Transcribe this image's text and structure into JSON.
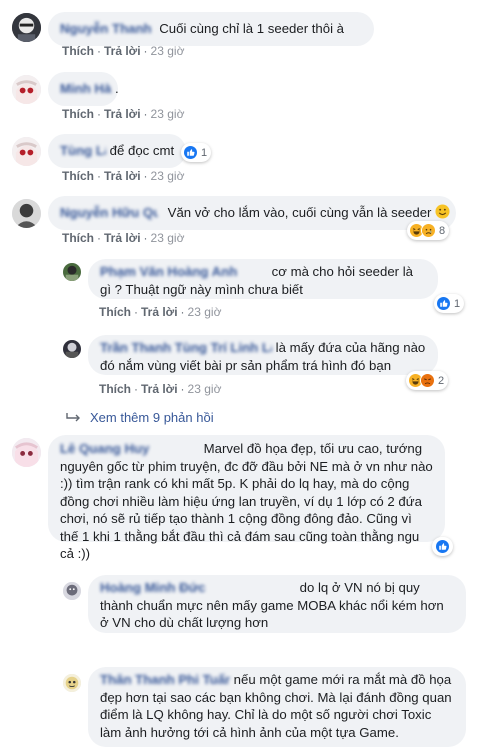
{
  "actions": {
    "like": "Thích",
    "reply": "Trả lời",
    "separator": "·"
  },
  "comments": [
    {
      "name": "Nguyễn Thanh",
      "text": "Cuối cùng chỉ là 1 seeder thôi à",
      "time": "23 giờ"
    },
    {
      "name": "Minh Hà",
      "text": ".",
      "time": "23 giờ"
    },
    {
      "name": "Tùng Lâm",
      "text": "để đọc cmt",
      "time": "23 giờ",
      "reaction_count": "1"
    },
    {
      "name": "Nguyễn Hữu Quang",
      "text": "Văn vở cho lắm vào, cuối cùng vẫn là seeder",
      "time": "23 giờ",
      "reaction_count": "8"
    },
    {
      "name": "Phạm Văn Hoàng Anh",
      "text": "cơ mà cho hỏi seeder là gì ? Thuật ngữ này mình chưa biết",
      "time": "23 giờ",
      "reaction_count": "1"
    },
    {
      "name": "Trần Thanh Tùng Trí Linh Lam",
      "text": "là mấy đứa của hãng nào đó nắm vùng viết bài pr sản phẩm trá hình đó bạn",
      "time": "23 giờ",
      "reaction_count": "2"
    },
    {
      "name": "Lê Quang Huy",
      "text": "Marvel đồ họa đẹp, tối ưu cao, tướng nguyên gốc từ phim truyện, đc đỡ đầu bởi NE mà ở vn như nào :)) tìm trận rank có khi mất 5p. K phải do lq hay, mà do cộng đồng chơi nhiều làm hiệu ứng lan truyền, ví dụ 1 lớp có 2 đứa chơi, nó sẽ rủ tiếp tạo thành 1 cộng đồng đông đảo. Cũng vì thế 1 khi 1 thằng bắt đầu thì cả đám sau cũng toàn thằng ngu cả :))",
      "reaction_count": ""
    },
    {
      "name": "Hoàng Minh Đức",
      "text": "do lq ở VN nó bị quy thành chuẩn mực nên mấy game MOBA khác nổi kém hơn ở VN cho dù chất lượng hơn"
    },
    {
      "name": "Thân Thanh Phi Tuấn",
      "text": "nếu một game mới ra mắt mà đồ họa đẹp hơn tại sao các bạn không chơi. Mà lại đánh đồng quan điểm là LQ không hay. Chỉ là do một số người chơi Toxic làm ảnh hưởng tới cả hình ảnh của một tựa Game."
    }
  ],
  "view_more": "Xem thêm 9 phản hồi",
  "colors": {
    "link": "#385898",
    "bubble": "#f0f2f5",
    "like": "#1877f2",
    "haha": "#f7b125",
    "angry": "#e9710f"
  }
}
